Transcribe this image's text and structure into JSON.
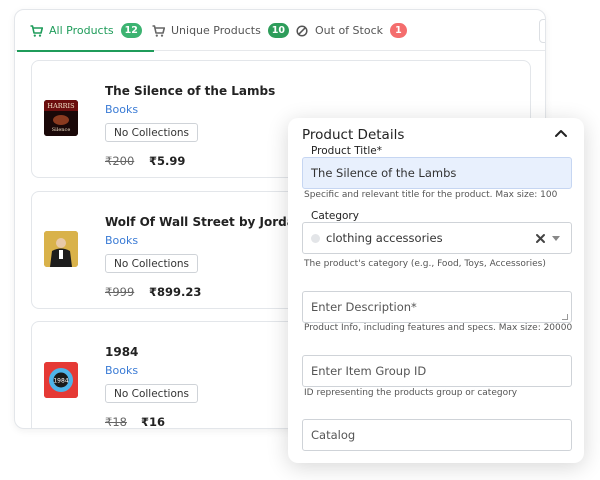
{
  "tabs": [
    {
      "label": "All Products",
      "count": "12",
      "badge_color": "#3cb371",
      "icon": "cart-icon"
    },
    {
      "label": "Unique Products",
      "count": "10",
      "badge_color": "#2e9d5b",
      "icon": "cart-icon"
    },
    {
      "label": "Out of Stock",
      "count": "1",
      "badge_color": "#f46d6d",
      "icon": "ban-icon"
    }
  ],
  "products": [
    {
      "title": "The Silence of the Lambs",
      "category": "Books",
      "collection": "No Collections",
      "old_price": "₹200",
      "new_price": "₹5.99",
      "thumb_text": "HARRIS",
      "thumb_sub": "Silence"
    },
    {
      "title": "Wolf Of Wall Street by Jordan",
      "category": "Books",
      "collection": "No Collections",
      "old_price": "₹999",
      "new_price": "₹899.23"
    },
    {
      "title": "1984",
      "category": "Books",
      "collection": "No Collections",
      "old_price": "₹18",
      "new_price": "₹16",
      "thumb_text": "1984"
    }
  ],
  "details": {
    "heading": "Product Details",
    "title_label": "Product Title*",
    "title_value": "The Silence of the Lambs",
    "title_hint": "Specific and relevant title for the product. Max size: 100",
    "category_label": "Category",
    "category_value": "clothing accessories",
    "category_hint": "The product's category (e.g., Food, Toys, Accessories)",
    "description_placeholder": "Enter Description*",
    "description_hint": "Product Info, including features and specs. Max size: 20000",
    "group_placeholder": "Enter Item Group ID",
    "group_hint": "ID representing the products group or category",
    "catalog_placeholder": "Catalog"
  },
  "colors": {
    "accent": "#1f9c5a",
    "link": "#3a7bd5",
    "filled_field": "#e8f0fd"
  }
}
